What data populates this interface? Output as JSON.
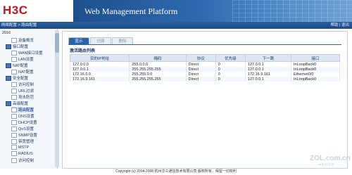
{
  "header": {
    "logo": "H3C",
    "banner_title": "Web Management Platform"
  },
  "navbar": {
    "breadcrumb": "网络配置 > 路由配置",
    "right_text": "帮助 | 退出"
  },
  "sidebar": {
    "root": "2016",
    "items": [
      {
        "label": "设备概览",
        "type": "doc"
      },
      {
        "label": "接口配置",
        "type": "folder"
      },
      {
        "label": "WAN接口设置",
        "type": "doc"
      },
      {
        "label": "LAN设置",
        "type": "doc"
      },
      {
        "label": "NAT配置",
        "type": "folder"
      },
      {
        "label": "NAT配置",
        "type": "doc"
      },
      {
        "label": "安全配置",
        "type": "folder"
      },
      {
        "label": "访问控制",
        "type": "doc"
      },
      {
        "label": "URL过滤",
        "type": "doc"
      },
      {
        "label": "攻击防范",
        "type": "doc"
      },
      {
        "label": "高级配置",
        "type": "folder"
      },
      {
        "label": "路由配置",
        "type": "doc",
        "selected": true
      },
      {
        "label": "DNS设置",
        "type": "doc"
      },
      {
        "label": "DHCP设置",
        "type": "doc"
      },
      {
        "label": "QoS设置",
        "type": "doc"
      },
      {
        "label": "SNMP设置",
        "type": "doc"
      },
      {
        "label": "带宽管理",
        "type": "doc"
      },
      {
        "label": "MSTP",
        "type": "doc"
      },
      {
        "label": "RADIUS",
        "type": "doc"
      },
      {
        "label": "访问控制",
        "type": "doc"
      }
    ]
  },
  "main": {
    "tabs": [
      {
        "label": "显示",
        "active": true
      },
      {
        "label": "创建",
        "active": false
      },
      {
        "label": "删除",
        "active": false
      }
    ],
    "section_title": "激活路由列表",
    "columns": [
      "目的IP地址",
      "掩码",
      "协议",
      "优先级",
      "下一跳",
      "接口"
    ],
    "rows": [
      [
        "127.0.0.0",
        "255.0.0.0",
        "Direct",
        "0",
        "127.0.0.1",
        "InLoopBack0"
      ],
      [
        "127.0.0.1",
        "255.255.255.255",
        "Direct",
        "0",
        "127.0.0.1",
        "InLoopBack0"
      ],
      [
        "172.16.0.0",
        "255.255.0.0",
        "Direct",
        "0",
        "172.16.9.161",
        "Ethernet0/0"
      ],
      [
        "172.16.9.161",
        "255.255.255.255",
        "Direct",
        "0",
        "127.0.0.1",
        "InLoopBack0"
      ]
    ]
  },
  "footer": {
    "copyright": "Copyright (c) 2004-2008 杭州华三通信技术有限公司 版权所有，保留一切权利"
  },
  "watermark": {
    "text": "ZOL.com.cn",
    "sub": "中关村在线"
  },
  "colors": {
    "brand_red": "#c8141e",
    "nav_blue": "#2a5f9e",
    "tab_active": "#2a64aa"
  }
}
